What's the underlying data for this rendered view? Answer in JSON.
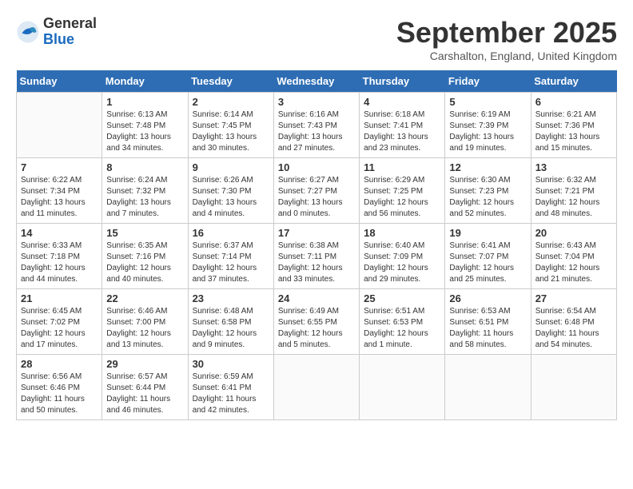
{
  "header": {
    "logo_general": "General",
    "logo_blue": "Blue",
    "month_title": "September 2025",
    "location": "Carshalton, England, United Kingdom"
  },
  "days_of_week": [
    "Sunday",
    "Monday",
    "Tuesday",
    "Wednesday",
    "Thursday",
    "Friday",
    "Saturday"
  ],
  "weeks": [
    [
      {
        "day": "",
        "info": ""
      },
      {
        "day": "1",
        "info": "Sunrise: 6:13 AM\nSunset: 7:48 PM\nDaylight: 13 hours\nand 34 minutes."
      },
      {
        "day": "2",
        "info": "Sunrise: 6:14 AM\nSunset: 7:45 PM\nDaylight: 13 hours\nand 30 minutes."
      },
      {
        "day": "3",
        "info": "Sunrise: 6:16 AM\nSunset: 7:43 PM\nDaylight: 13 hours\nand 27 minutes."
      },
      {
        "day": "4",
        "info": "Sunrise: 6:18 AM\nSunset: 7:41 PM\nDaylight: 13 hours\nand 23 minutes."
      },
      {
        "day": "5",
        "info": "Sunrise: 6:19 AM\nSunset: 7:39 PM\nDaylight: 13 hours\nand 19 minutes."
      },
      {
        "day": "6",
        "info": "Sunrise: 6:21 AM\nSunset: 7:36 PM\nDaylight: 13 hours\nand 15 minutes."
      }
    ],
    [
      {
        "day": "7",
        "info": "Sunrise: 6:22 AM\nSunset: 7:34 PM\nDaylight: 13 hours\nand 11 minutes."
      },
      {
        "day": "8",
        "info": "Sunrise: 6:24 AM\nSunset: 7:32 PM\nDaylight: 13 hours\nand 7 minutes."
      },
      {
        "day": "9",
        "info": "Sunrise: 6:26 AM\nSunset: 7:30 PM\nDaylight: 13 hours\nand 4 minutes."
      },
      {
        "day": "10",
        "info": "Sunrise: 6:27 AM\nSunset: 7:27 PM\nDaylight: 13 hours\nand 0 minutes."
      },
      {
        "day": "11",
        "info": "Sunrise: 6:29 AM\nSunset: 7:25 PM\nDaylight: 12 hours\nand 56 minutes."
      },
      {
        "day": "12",
        "info": "Sunrise: 6:30 AM\nSunset: 7:23 PM\nDaylight: 12 hours\nand 52 minutes."
      },
      {
        "day": "13",
        "info": "Sunrise: 6:32 AM\nSunset: 7:21 PM\nDaylight: 12 hours\nand 48 minutes."
      }
    ],
    [
      {
        "day": "14",
        "info": "Sunrise: 6:33 AM\nSunset: 7:18 PM\nDaylight: 12 hours\nand 44 minutes."
      },
      {
        "day": "15",
        "info": "Sunrise: 6:35 AM\nSunset: 7:16 PM\nDaylight: 12 hours\nand 40 minutes."
      },
      {
        "day": "16",
        "info": "Sunrise: 6:37 AM\nSunset: 7:14 PM\nDaylight: 12 hours\nand 37 minutes."
      },
      {
        "day": "17",
        "info": "Sunrise: 6:38 AM\nSunset: 7:11 PM\nDaylight: 12 hours\nand 33 minutes."
      },
      {
        "day": "18",
        "info": "Sunrise: 6:40 AM\nSunset: 7:09 PM\nDaylight: 12 hours\nand 29 minutes."
      },
      {
        "day": "19",
        "info": "Sunrise: 6:41 AM\nSunset: 7:07 PM\nDaylight: 12 hours\nand 25 minutes."
      },
      {
        "day": "20",
        "info": "Sunrise: 6:43 AM\nSunset: 7:04 PM\nDaylight: 12 hours\nand 21 minutes."
      }
    ],
    [
      {
        "day": "21",
        "info": "Sunrise: 6:45 AM\nSunset: 7:02 PM\nDaylight: 12 hours\nand 17 minutes."
      },
      {
        "day": "22",
        "info": "Sunrise: 6:46 AM\nSunset: 7:00 PM\nDaylight: 12 hours\nand 13 minutes."
      },
      {
        "day": "23",
        "info": "Sunrise: 6:48 AM\nSunset: 6:58 PM\nDaylight: 12 hours\nand 9 minutes."
      },
      {
        "day": "24",
        "info": "Sunrise: 6:49 AM\nSunset: 6:55 PM\nDaylight: 12 hours\nand 5 minutes."
      },
      {
        "day": "25",
        "info": "Sunrise: 6:51 AM\nSunset: 6:53 PM\nDaylight: 12 hours\nand 1 minute."
      },
      {
        "day": "26",
        "info": "Sunrise: 6:53 AM\nSunset: 6:51 PM\nDaylight: 11 hours\nand 58 minutes."
      },
      {
        "day": "27",
        "info": "Sunrise: 6:54 AM\nSunset: 6:48 PM\nDaylight: 11 hours\nand 54 minutes."
      }
    ],
    [
      {
        "day": "28",
        "info": "Sunrise: 6:56 AM\nSunset: 6:46 PM\nDaylight: 11 hours\nand 50 minutes."
      },
      {
        "day": "29",
        "info": "Sunrise: 6:57 AM\nSunset: 6:44 PM\nDaylight: 11 hours\nand 46 minutes."
      },
      {
        "day": "30",
        "info": "Sunrise: 6:59 AM\nSunset: 6:41 PM\nDaylight: 11 hours\nand 42 minutes."
      },
      {
        "day": "",
        "info": ""
      },
      {
        "day": "",
        "info": ""
      },
      {
        "day": "",
        "info": ""
      },
      {
        "day": "",
        "info": ""
      }
    ]
  ]
}
